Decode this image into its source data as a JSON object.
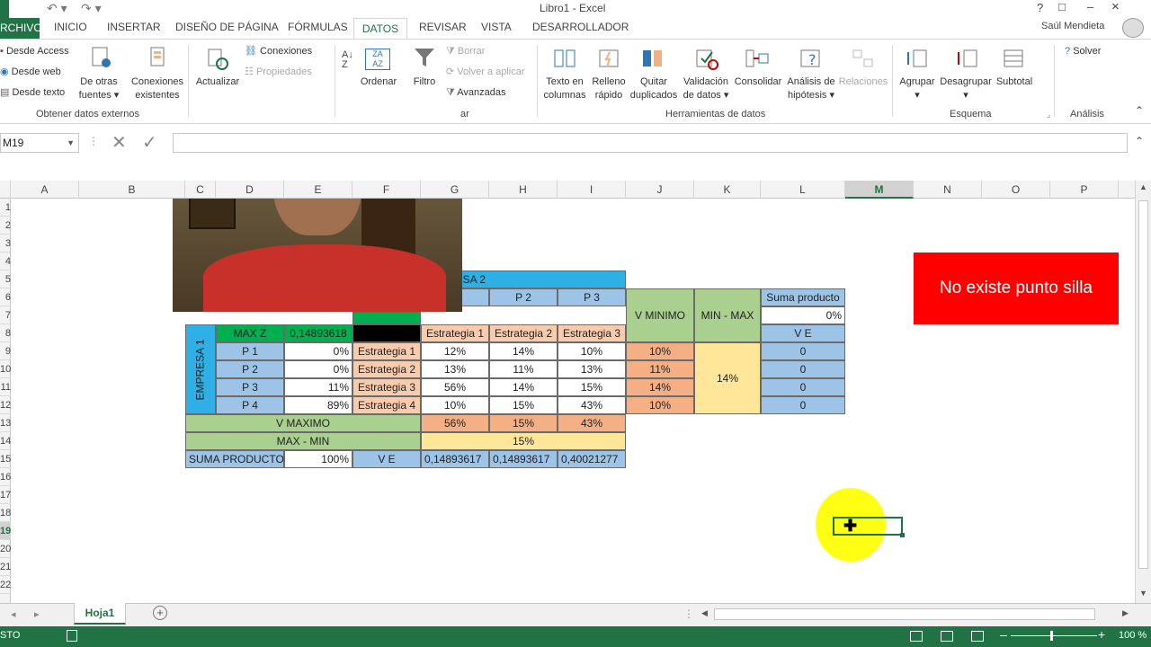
{
  "window": {
    "title": "Libro1 - Excel",
    "user": "Saúl Mendieta",
    "help": "?",
    "restore": "□",
    "minimize": "–",
    "close": "×"
  },
  "tabs": [
    "RCHIVO",
    "INICIO",
    "INSERTAR",
    "DISEÑO DE PÁGINA",
    "FÓRMULAS",
    "DATOS",
    "REVISAR",
    "VISTA",
    "DESARROLLADOR"
  ],
  "ribbon": {
    "external": {
      "access": "Desde Access",
      "web": "Desde web",
      "text": "Desde texto",
      "other1": "De otras",
      "other2": "fuentes ▾",
      "existing1": "Conexiones",
      "existing2": "existentes",
      "group": "Obtener datos externos"
    },
    "connections": {
      "refresh": "Actualizar",
      "connections": "Conexiones",
      "properties": "Propiedades"
    },
    "sort": {
      "sort": "Ordenar",
      "filter": "Filtro",
      "clear": "Borrar",
      "reapply": "Volver a aplicar",
      "advanced": "Avanzadas",
      "group_tail": "ar"
    },
    "tools": {
      "text_cols1": "Texto en",
      "text_cols2": "columnas",
      "flash1": "Relleno",
      "flash2": "rápido",
      "dup1": "Quitar",
      "dup2": "duplicados",
      "val1": "Validación",
      "val2": "de datos ▾",
      "consolidate": "Consolidar",
      "whatif1": "Análisis de",
      "whatif2": "hipótesis ▾",
      "relations": "Relaciones",
      "group": "Herramientas de datos"
    },
    "outline": {
      "group_btn": "Agrupar",
      "ungroup": "Desagrupar",
      "subtotal": "Subtotal",
      "group": "Esquema"
    },
    "analysis": {
      "solver": "Solver",
      "group": "Análisis"
    }
  },
  "formula_bar": {
    "name_box": "M19",
    "formula": ""
  },
  "columns": [
    "A",
    "B",
    "C",
    "D",
    "E",
    "F",
    "G",
    "H",
    "I",
    "J",
    "K",
    "L",
    "M",
    "N",
    "O",
    "P"
  ],
  "rows": [
    "1",
    "2",
    "3",
    "4",
    "5",
    "6",
    "7",
    "8",
    "9",
    "10",
    "11",
    "12",
    "13",
    "14",
    "15",
    "16",
    "17",
    "18",
    "19",
    "20",
    "21",
    "22"
  ],
  "cells": {
    "empresa2": "EMPRESA 2",
    "p2": "P 2",
    "p3": "P 3",
    "v_minimo": "V MINIMO",
    "min_max": "MIN - MAX",
    "suma_producto_hdr": "Suma producto",
    "suma_producto_val": "0%",
    "ve": "V E",
    "max_z": "MAX Z",
    "max_z_val": "0,14893618",
    "empresa1": "EMPRESA 1",
    "estrategias_col": [
      "Estrategia 1",
      "Estrategia 2",
      "Estrategia 3"
    ],
    "rows_data": [
      {
        "p": "P 1",
        "prob": "0%",
        "est": "Estrategia 1",
        "v": [
          "12%",
          "14%",
          "10%"
        ],
        "vmin": "10%",
        "ve": "0"
      },
      {
        "p": "P 2",
        "prob": "0%",
        "est": "Estrategia 2",
        "v": [
          "13%",
          "11%",
          "13%"
        ],
        "vmin": "11%",
        "ve": "0"
      },
      {
        "p": "P 3",
        "prob": "11%",
        "est": "Estrategia 3",
        "v": [
          "56%",
          "14%",
          "15%"
        ],
        "vmin": "14%",
        "ve": "0"
      },
      {
        "p": "P 4",
        "prob": "89%",
        "est": "Estrategia 4",
        "v": [
          "10%",
          "15%",
          "43%"
        ],
        "vmin": "10%",
        "ve": "0"
      }
    ],
    "min_max_val": "14%",
    "v_maximo": "V MAXIMO",
    "v_maximo_vals": [
      "56%",
      "15%",
      "43%"
    ],
    "max_min": "MAX - MIN",
    "max_min_val": "15%",
    "suma_producto": "SUMA PRODUCTO",
    "suma_producto_pct": "100%",
    "ve2": "V E",
    "ve_vals": [
      "0,14893617",
      "0,14893617",
      "0,40021277"
    ]
  },
  "note": "No existe punto silla",
  "sheet_tab": "Hoja1",
  "status": {
    "left": "STO",
    "zoom": "100 %"
  },
  "colors": {
    "excel_green": "#217346",
    "note_red": "#ff0000",
    "highlight": "#ffff00"
  }
}
